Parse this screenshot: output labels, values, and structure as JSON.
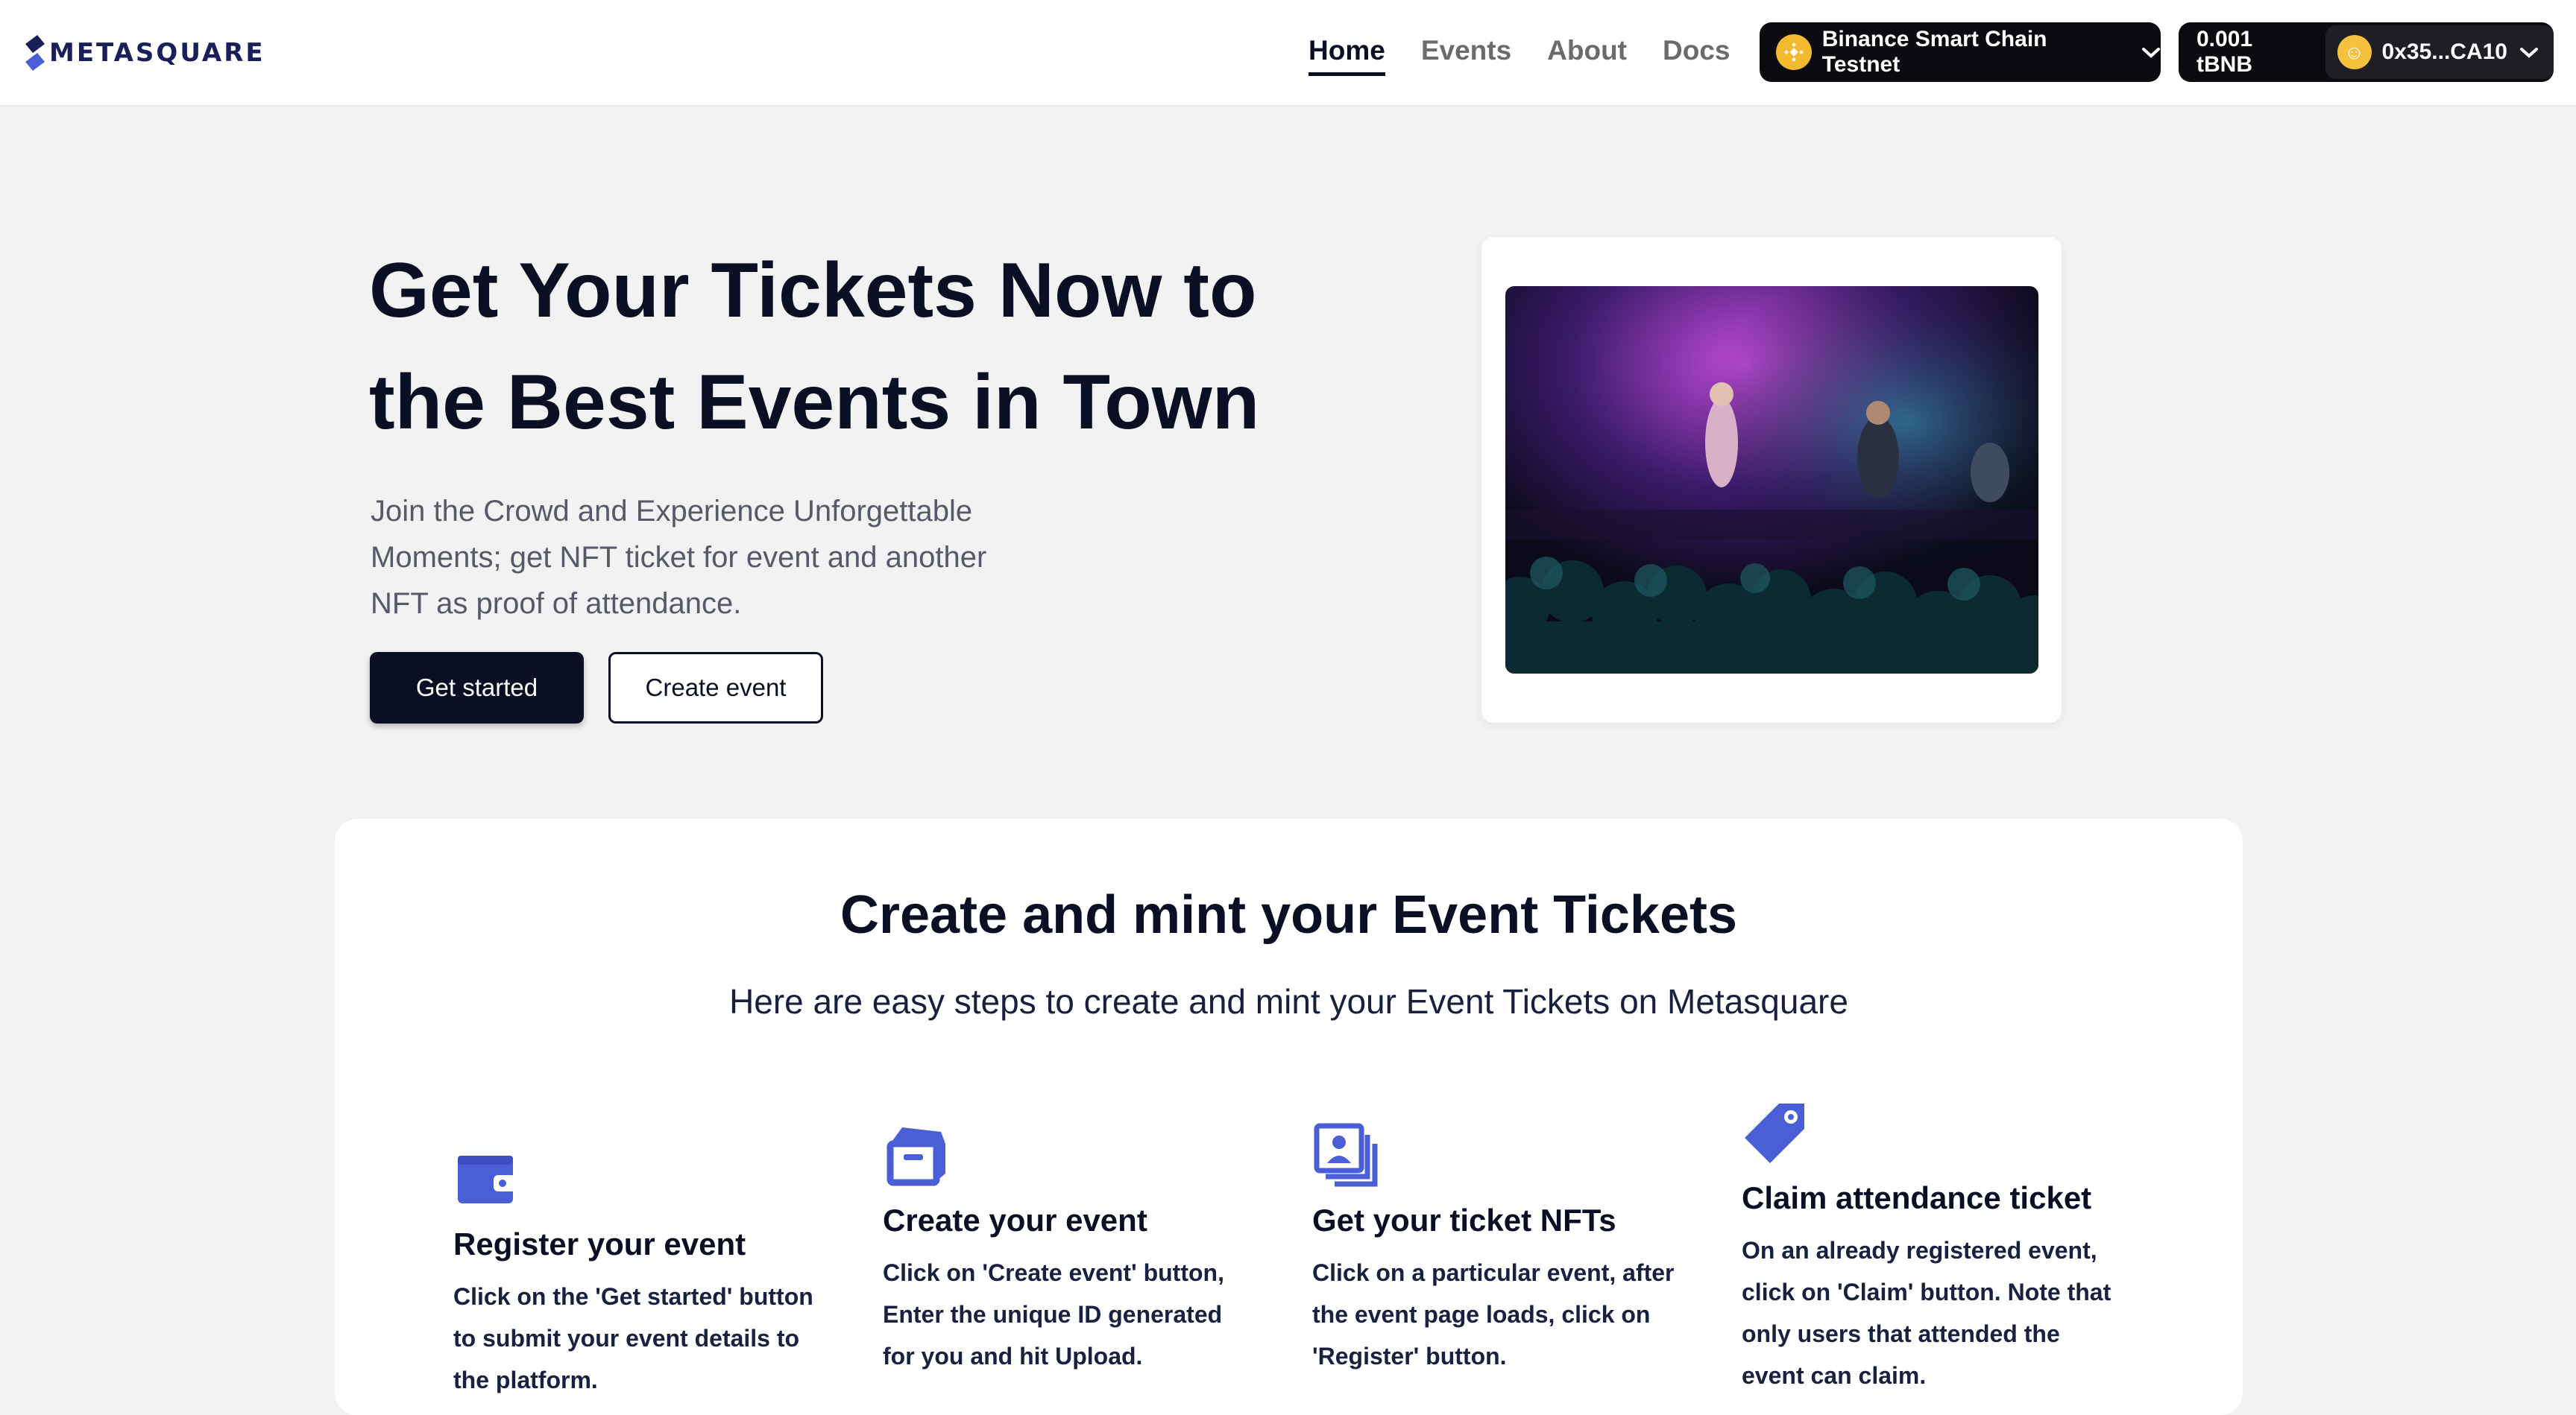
{
  "header": {
    "logo_text": "METASQUARE",
    "nav": [
      {
        "label": "Home",
        "active": true
      },
      {
        "label": "Events",
        "active": false
      },
      {
        "label": "About",
        "active": false
      },
      {
        "label": "Docs",
        "active": false
      }
    ],
    "chain_selector": {
      "label": "Binance Smart Chain Testnet",
      "icon": "bnb-icon"
    },
    "wallet": {
      "balance": "0.001 tBNB",
      "account": "0x35...CA10"
    }
  },
  "hero": {
    "title_line1": "Get Your Tickets Now to",
    "title_line2": "the Best Events in Town",
    "subtitle_line1": "Join the Crowd and Experience Unforgettable",
    "subtitle_line2": "Moments; get NFT ticket for event and another",
    "subtitle_line3": "NFT as proof of attendance.",
    "primary_button": "Get started",
    "secondary_button": "Create event"
  },
  "steps": {
    "title": "Create and mint your Event Tickets",
    "subtitle": "Here are easy steps to create and mint your Event Tickets on Metasquare",
    "items": [
      {
        "icon": "wallet-icon",
        "title": "Register your event",
        "lines": [
          "Click on the 'Get started' button",
          "to submit your event details to",
          "the platform."
        ]
      },
      {
        "icon": "box-icon",
        "title": "Create your event",
        "lines": [
          "Click on 'Create event' button,",
          "Enter the unique ID generated",
          "for you and hit Upload."
        ]
      },
      {
        "icon": "photos-icon",
        "title": "Get your ticket NFTs",
        "lines": [
          "Click on a particular event, after",
          "the event page loads, click on",
          "'Register' button."
        ]
      },
      {
        "icon": "tag-icon",
        "title": "Claim attendance ticket",
        "lines": [
          "On an already registered event,",
          "click on 'Claim' button. Note that",
          "only users that attended the",
          "event can claim."
        ]
      }
    ]
  },
  "colors": {
    "primary": "#0b0f24",
    "accent_icon": "#4a5fd6",
    "background": "#f2f2f2"
  }
}
